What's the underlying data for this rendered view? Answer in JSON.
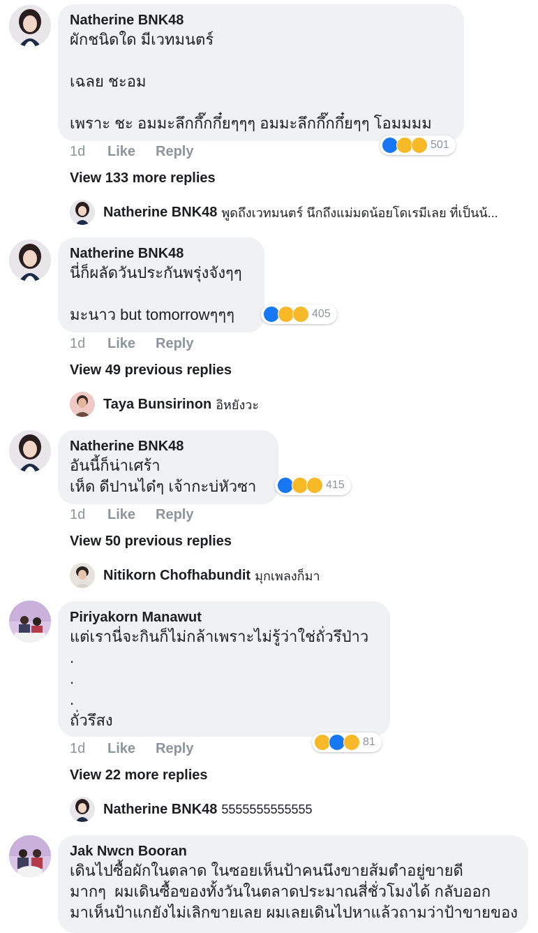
{
  "comments": [
    {
      "author": "Natherine BNK48",
      "avatar_icon": "profile-photo-girl",
      "lines": [
        "ผักชนิดใด มีเวทมนตร์",
        "",
        "เฉลย ชะอม",
        "",
        "เพราะ ชะ อมมะลึกกึ๊กกึ๋ยๆๆๆ อมมะลึกกึ๊กกึ๋ยๆๆ โอมมมม"
      ],
      "reactions": {
        "icons": [
          "like",
          "haha",
          "sad"
        ],
        "count": "501"
      },
      "time": "1d",
      "like": "Like",
      "reply": "Reply",
      "view_more": "View 133 more replies",
      "latest_reply": {
        "name": "Natherine BNK48",
        "text": "พูดถึงเวทมนตร์ นึกถึงแม่มดน้อยโดเรมีเลย ที่เป็นน้..."
      }
    },
    {
      "author": "Natherine BNK48",
      "avatar_icon": "profile-photo-girl",
      "lines": [
        "นี่ก็ผลัดวันประกันพรุ่งจังๆๆ",
        "",
        "มะนาว but tomorrowๆๆๆ"
      ],
      "reactions": {
        "icons": [
          "like",
          "haha",
          "sad"
        ],
        "count": "405"
      },
      "time": "1d",
      "like": "Like",
      "reply": "Reply",
      "view_more": "View 49 previous replies",
      "latest_reply": {
        "name": "Taya Bunsirinon",
        "text": "อิหยังวะ"
      }
    },
    {
      "author": "Natherine BNK48",
      "avatar_icon": "profile-photo-girl",
      "lines": [
        "อันนี้ก็น่าเศร้า",
        "เห็ด ดีปานได๋ๆ เจ้ากะบ่หัวซา"
      ],
      "reactions": {
        "icons": [
          "like",
          "haha",
          "sad"
        ],
        "count": "415"
      },
      "time": "1d",
      "like": "Like",
      "reply": "Reply",
      "view_more": "View 50 previous replies",
      "latest_reply": {
        "name": "Nitikorn Chofhabundit",
        "text": "มุกเพลงก็มา"
      }
    },
    {
      "author": "Piriyakorn Manawut",
      "avatar_icon": "profile-photo-event",
      "lines": [
        "แต่เรานี่จะกินก็ไม่กล้าเพราะไม่รู้ว่าใช่ถั่วรึป่าว",
        ".",
        ".",
        ".",
        "ถั่วรึสง"
      ],
      "reactions": {
        "icons": [
          "haha",
          "like",
          "sad"
        ],
        "count": "81"
      },
      "time": "1d",
      "like": "Like",
      "reply": "Reply",
      "view_more": "View 22 more replies",
      "latest_reply": {
        "name": "Natherine BNK48",
        "text": "5555555555555"
      }
    },
    {
      "author": "Jak Nwcn Booran",
      "avatar_icon": "profile-photo-event",
      "lines": [
        "เดินไปซื้อผักในตลาด ในซอยเห็นป้าคนนึงขายส้มตำอยู่ขายดี",
        "มากๆ  ผมเดินซื้อของทั้งวันในตลาดประมาณสี่ชั่วโมงได้ กลับออก",
        "มาเห็นป้าแกยังไม่เลิกขายเลย ผมเลยเดินไปหาแล้วถามว่าป้าขายของ"
      ]
    }
  ],
  "colors": {
    "bubble": "#eff1f3",
    "like_blue": "#1877f2",
    "emoji_yellow": "#f7b928",
    "meta_gray": "#8d949e"
  }
}
